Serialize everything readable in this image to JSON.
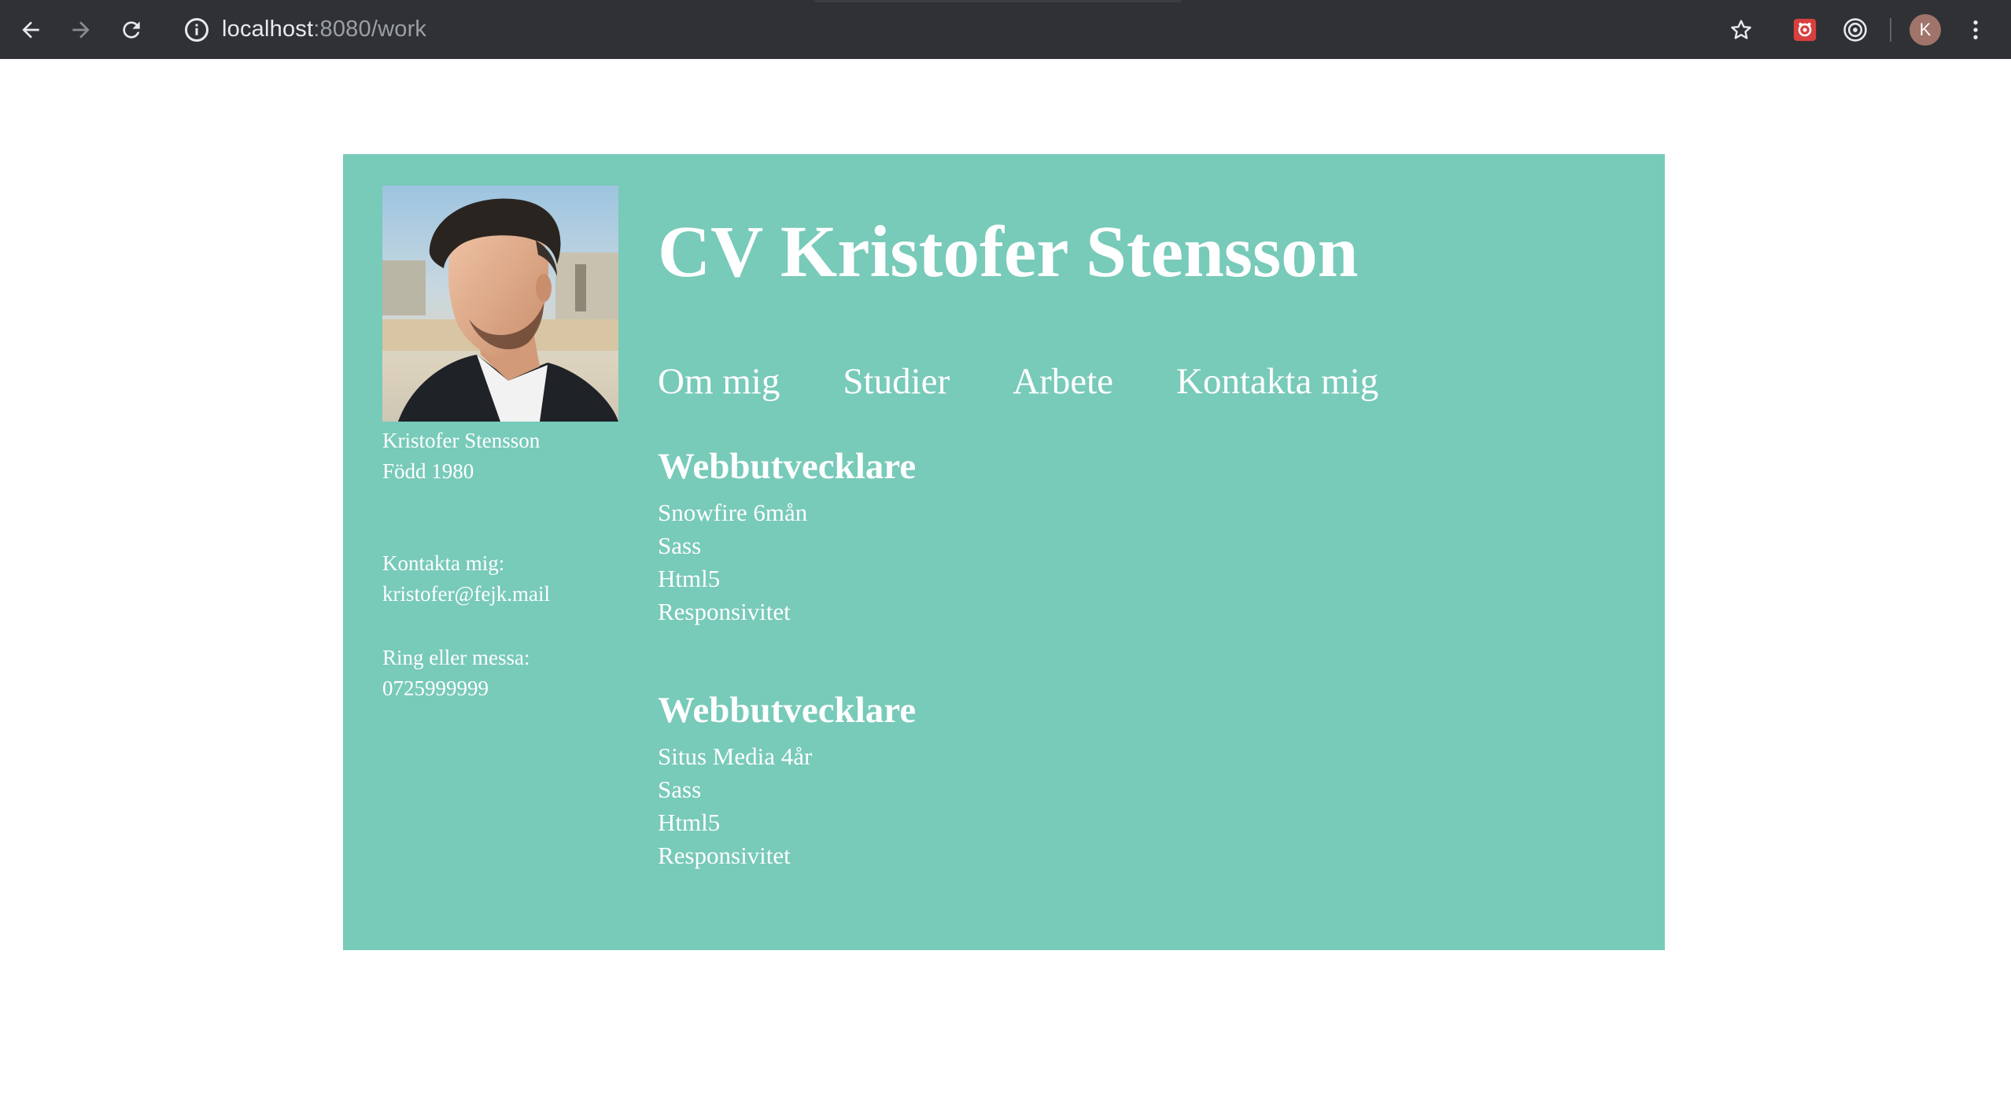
{
  "browser": {
    "url_host": "localhost",
    "url_rest": ":8080/work",
    "profile_initial": "K"
  },
  "profile": {
    "name": "Kristofer Stensson",
    "born": "Född 1980",
    "contact_label": "Kontakta mig:",
    "email": "kristofer@fejk.mail",
    "phone_label": "Ring eller messa:",
    "phone": "0725999999"
  },
  "header": {
    "title": "CV Kristofer Stensson"
  },
  "nav": {
    "items": [
      "Om mig",
      "Studier",
      "Arbete",
      "Kontakta mig"
    ]
  },
  "jobs": [
    {
      "title": "Webbutvecklare",
      "lines": [
        "Snowfire 6mån",
        "Sass",
        "Html5",
        "Responsivitet"
      ]
    },
    {
      "title": "Webbutvecklare",
      "lines": [
        "Situs Media 4år",
        "Sass",
        "Html5",
        "Responsivitet"
      ]
    }
  ],
  "colors": {
    "card_bg": "#78cab9",
    "chrome_bg": "#2f3135"
  }
}
